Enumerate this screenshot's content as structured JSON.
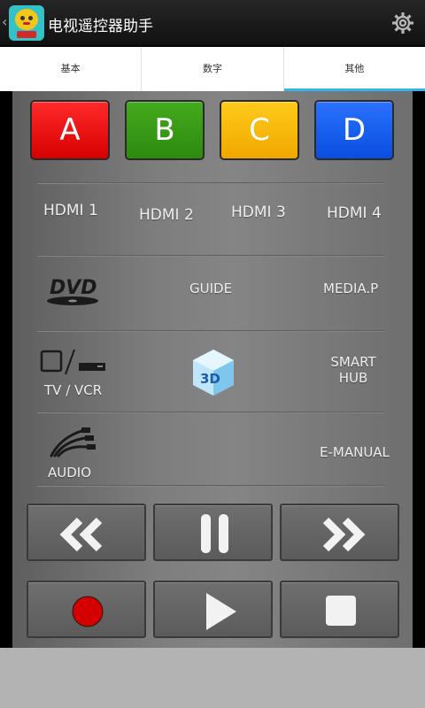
{
  "appbar": {
    "back_glyph": "‹",
    "title": "电视遥控器助手",
    "icons": {
      "logo": "app-logo",
      "settings": "gear-icon"
    }
  },
  "tabs": [
    {
      "label": "基本",
      "active": false
    },
    {
      "label": "数字",
      "active": false
    },
    {
      "label": "其他",
      "active": true
    }
  ],
  "color_buttons": [
    {
      "label": "A",
      "color": "#e00000"
    },
    {
      "label": "B",
      "color": "#369a12"
    },
    {
      "label": "C",
      "color": "#f7b800"
    },
    {
      "label": "D",
      "color": "#0b55f0"
    }
  ],
  "hdmi": [
    "HDMI 1",
    "HDMI 2",
    "HDMI 3",
    "HDMI 4"
  ],
  "row_media": {
    "dvd_icon": "dvd-logo-icon",
    "guide": "GUIDE",
    "media": "MEDIA.P"
  },
  "row_tv": {
    "tvvcr": "TV / VCR",
    "tvvcr_icon": "tv-vcr-icon",
    "threed_icon": "3d-cube-icon",
    "threed_text": "3D",
    "smart_hub_line1": "SMART",
    "smart_hub_line2": "HUB"
  },
  "row_audio": {
    "audio": "AUDIO",
    "audio_icon": "audio-cables-icon",
    "emanual": "E-MANUAL"
  },
  "transport": [
    {
      "name": "rewind",
      "icon": "rewind-icon"
    },
    {
      "name": "pause",
      "icon": "pause-icon"
    },
    {
      "name": "fast-forward",
      "icon": "fast-forward-icon"
    },
    {
      "name": "record",
      "icon": "record-icon"
    },
    {
      "name": "play",
      "icon": "play-icon"
    },
    {
      "name": "stop",
      "icon": "stop-icon"
    }
  ],
  "colors": {
    "tab_indicator": "#33b5e5",
    "record": "#d40000",
    "bottom_strip": "#b3b3b3"
  }
}
